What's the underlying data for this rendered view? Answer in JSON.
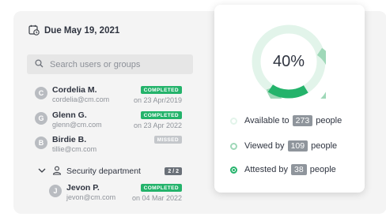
{
  "due": {
    "label": "Due May 19, 2021"
  },
  "search": {
    "placeholder": "Search users or groups"
  },
  "users": [
    {
      "initial": "C",
      "name": "Cordelia M.",
      "email": "cordelia@cm.com",
      "status": "COMPLETED",
      "date": "on 23 Apr/2019"
    },
    {
      "initial": "G",
      "name": "Glenn G.",
      "email": "glenn@cm.com",
      "status": "COMPLETED",
      "date": "on 23 Apr 2022"
    },
    {
      "initial": "B",
      "name": "Birdie B.",
      "email": "tillie@cm.com",
      "status": "MISSED",
      "date": ""
    }
  ],
  "group": {
    "name": "Security department",
    "count": "2 / 2",
    "member": {
      "initial": "J",
      "name": "Jevon P.",
      "email": "jevon@cm.com",
      "status": "COMPLETED",
      "date": "on 04 Mar 2022"
    }
  },
  "stats": {
    "percent": "40%",
    "available": {
      "prefix": "Available to",
      "value": "273",
      "suffix": "people"
    },
    "viewed": {
      "prefix": "Viewed by",
      "value": "109",
      "suffix": "people"
    },
    "attested": {
      "prefix": "Attested by",
      "value": "38",
      "suffix": "people"
    }
  },
  "colors": {
    "green": "#24b36b",
    "light_green": "#9fd8b8",
    "pale_green": "#e2f4ea"
  }
}
